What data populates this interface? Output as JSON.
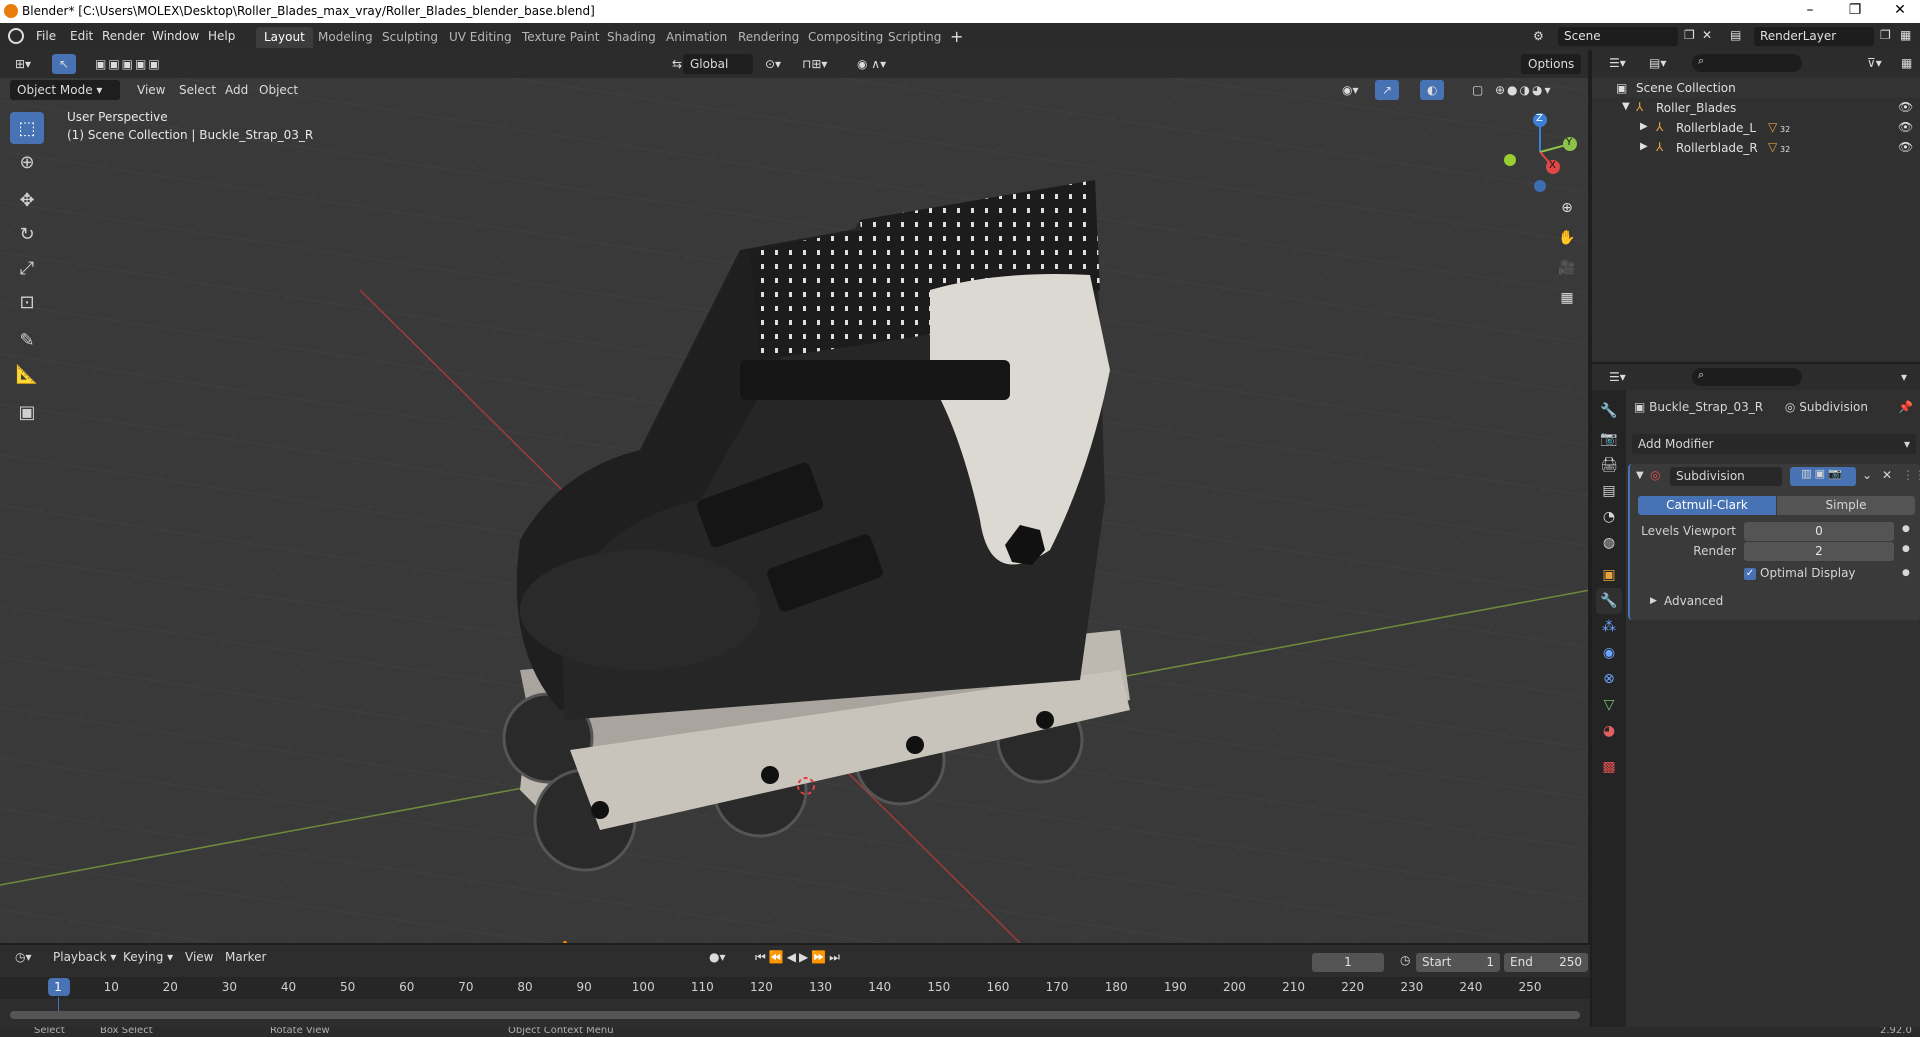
{
  "titlebar": {
    "text": "Blender* [C:\\Users\\MOLEX\\Desktop\\Roller_Blades_max_vray/Roller_Blades_blender_base.blend]"
  },
  "menubar": {
    "menus": [
      "File",
      "Edit",
      "Render",
      "Window",
      "Help"
    ],
    "tabs": [
      "Layout",
      "Modeling",
      "Sculpting",
      "UV Editing",
      "Texture Paint",
      "Shading",
      "Animation",
      "Rendering",
      "Compositing",
      "Scripting"
    ],
    "active_tab": "Layout",
    "scene": "Scene",
    "render_layer": "RenderLayer"
  },
  "viewport": {
    "header": {
      "mode": "Object Mode",
      "menus": [
        "View",
        "Select",
        "Add",
        "Object"
      ],
      "orientation": "Global",
      "options": "Options"
    },
    "overlay": {
      "perspective": "User Perspective",
      "collection": "(1) Scene Collection | Buckle_Strap_03_R"
    },
    "gizmo": {
      "z": "Z",
      "y": "Y",
      "x": "X"
    },
    "tools": [
      "select-box",
      "cursor",
      "move",
      "rotate",
      "scale",
      "transform",
      "annotate",
      "measure",
      "add-cube"
    ]
  },
  "timeline": {
    "menus": [
      "Playback",
      "Keying",
      "View",
      "Marker"
    ],
    "current_frame": "1",
    "start_label": "Start",
    "start": "1",
    "end_label": "End",
    "end": "250",
    "ticks": [
      "1",
      "10",
      "20",
      "30",
      "40",
      "50",
      "60",
      "70",
      "80",
      "90",
      "100",
      "110",
      "120",
      "130",
      "140",
      "150",
      "160",
      "170",
      "180",
      "190",
      "200",
      "210",
      "220",
      "230",
      "240",
      "250"
    ]
  },
  "statusbar": {
    "select": "Select",
    "box_select": "Box Select",
    "rotate": "Rotate View",
    "context": "Object Context Menu",
    "version": "2.92.0"
  },
  "outliner": {
    "root": "Scene Collection",
    "items": [
      {
        "label": "Roller_Blades",
        "level": 1
      },
      {
        "label": "Rollerblade_L",
        "level": 2,
        "badge": "32"
      },
      {
        "label": "Rollerblade_R",
        "level": 2,
        "badge": "32"
      }
    ]
  },
  "properties": {
    "object": "Buckle_Strap_03_R",
    "modifier_name": "Subdivision",
    "add_modifier": "Add Modifier",
    "panel_name": "Subdivision",
    "method_a": "Catmull-Clark",
    "method_b": "Simple",
    "levels_viewport_label": "Levels Viewport",
    "levels_viewport": "0",
    "render_label": "Render",
    "render": "2",
    "optimal_display": "Optimal Display",
    "advanced": "Advanced"
  },
  "colors": {
    "accent": "#4772b3",
    "bg_viewport": "#393939",
    "panel": "#303030"
  }
}
